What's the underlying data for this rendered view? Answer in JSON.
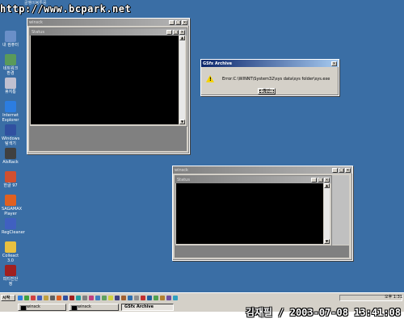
{
  "watermark": "http://www.bcpark.net",
  "top_caption": "골뱅이봉투몽",
  "desktop_icons": [
    {
      "label": "내 컴퓨터",
      "color": "#6a8fc8"
    },
    {
      "label": "네트워크 환경",
      "color": "#5a9a5a"
    },
    {
      "label": "휴지통",
      "color": "#c0c0d0"
    },
    {
      "label": "Internet Explorer",
      "color": "#2c7de0"
    },
    {
      "label": "Windows 탐색기",
      "color": "#3050a0"
    },
    {
      "label": "AlsRack",
      "color": "#404040"
    },
    {
      "label": "한글 97",
      "color": "#d05030"
    },
    {
      "label": "SAGAMAX Player",
      "color": "#e06020"
    },
    {
      "label": "RegCleaner",
      "color": "#4060c0"
    },
    {
      "label": "Colleact 3.0",
      "color": "#e8c040"
    },
    {
      "label": "피티진단정",
      "color": "#a02020"
    }
  ],
  "window1": {
    "title": "winsck",
    "inner_title": "Status"
  },
  "window2": {
    "title": "winsck",
    "inner_title": "Status"
  },
  "dialog": {
    "title": "GSfx Archive",
    "message": "Error:C:\\WINNT\\System32\\sys data\\sys folder\\sys.exe",
    "ok_label": "확인"
  },
  "taskbar": {
    "start_label": "시작",
    "buttons": [
      {
        "label": "winsck"
      },
      {
        "label": "winsck"
      },
      {
        "label": "GSfx Archive"
      }
    ],
    "clock": "오후 1:31",
    "quicklaunch_colors": [
      "#2c7de0",
      "#40a040",
      "#d04040",
      "#4060c0",
      "#c0a040",
      "#606060",
      "#e06020",
      "#3050a0",
      "#a02020",
      "#20a0a0",
      "#808080",
      "#c04080",
      "#4080c0",
      "#60a060",
      "#d0d040",
      "#404080",
      "#a06030",
      "#3070b0",
      "#909090",
      "#c03030",
      "#2060a0",
      "#50a050",
      "#b08030",
      "#7050a0",
      "#30a0c0"
    ]
  },
  "stamp": "김재필 / 2003-07-08 13:41:08",
  "colors": {
    "desktop": "#3a6ea5",
    "title_active": "#0a246a",
    "title_inactive": "#808080"
  }
}
